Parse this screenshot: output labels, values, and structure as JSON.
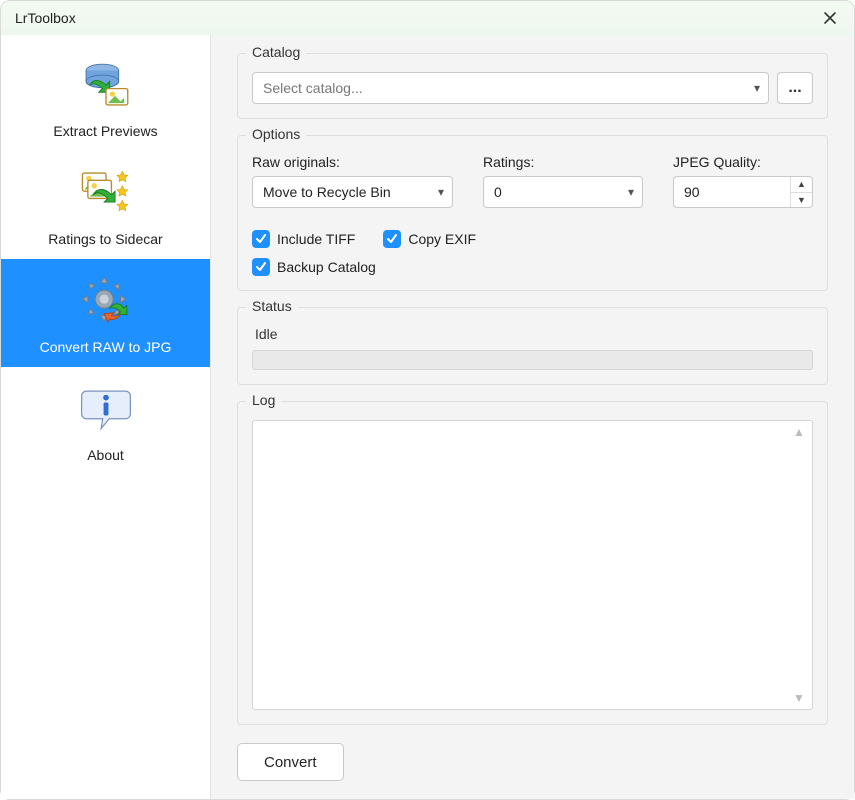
{
  "window": {
    "title": "LrToolbox"
  },
  "sidebar": {
    "items": [
      {
        "label": "Extract Previews",
        "icon": "extract-previews-icon"
      },
      {
        "label": "Ratings to Sidecar",
        "icon": "ratings-sidecar-icon"
      },
      {
        "label": "Convert RAW to JPG",
        "icon": "convert-raw-icon"
      },
      {
        "label": "About",
        "icon": "about-icon"
      }
    ],
    "selected_index": 2
  },
  "catalog": {
    "legend": "Catalog",
    "placeholder": "Select catalog...",
    "browse_label": "..."
  },
  "options": {
    "legend": "Options",
    "raw_label": "Raw originals:",
    "raw_value": "Move to Recycle Bin",
    "ratings_label": "Ratings:",
    "ratings_value": "0",
    "jpeg_label": "JPEG Quality:",
    "jpeg_value": "90",
    "include_tiff_label": "Include TIFF",
    "include_tiff_checked": true,
    "copy_exif_label": "Copy EXIF",
    "copy_exif_checked": true,
    "backup_catalog_label": "Backup Catalog",
    "backup_catalog_checked": true
  },
  "status": {
    "legend": "Status",
    "text": "Idle"
  },
  "log": {
    "legend": "Log",
    "content": ""
  },
  "convert_label": "Convert"
}
